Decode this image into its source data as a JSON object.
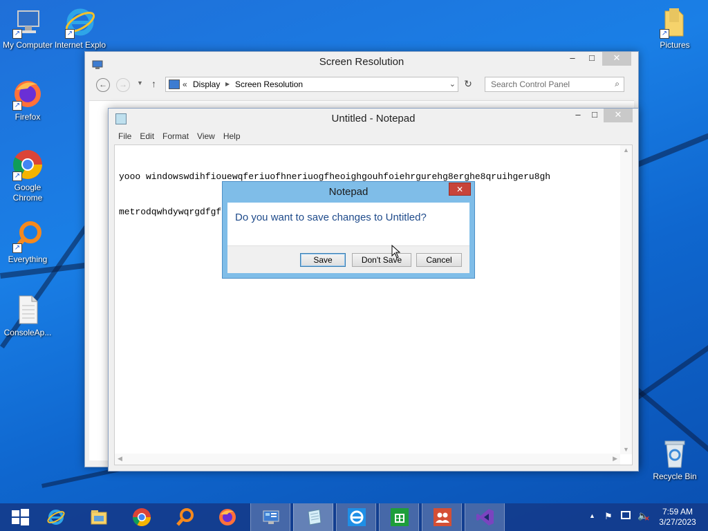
{
  "desktop": {
    "icons": [
      {
        "label": "My Computer",
        "icon": "computer-icon"
      },
      {
        "label": "Internet Explo",
        "icon": "internet-explorer-icon"
      },
      {
        "label": "Firefox",
        "icon": "firefox-icon"
      },
      {
        "label": "Google Chrome",
        "icon": "chrome-icon"
      },
      {
        "label": "Everything",
        "icon": "everything-search-icon"
      },
      {
        "label": "ConsoleAp...",
        "icon": "file-icon"
      },
      {
        "label": "Pictures",
        "icon": "folder-icon"
      },
      {
        "label": "Recycle Bin",
        "icon": "recycle-bin-icon"
      }
    ]
  },
  "control_panel": {
    "title": "Screen Resolution",
    "breadcrumb": {
      "root": "«",
      "parts": [
        "Display",
        "Screen Resolution"
      ]
    },
    "search_placeholder": "Search Control Panel",
    "controls": {
      "minimize": "–",
      "maximize": "□",
      "close": "✕"
    }
  },
  "notepad": {
    "title": "Untitled - Notepad",
    "menu": [
      "File",
      "Edit",
      "Format",
      "View",
      "Help"
    ],
    "content_line1": "yooo windowswdihfiouewqferiuofhneriuogfheoighgouhfoiehrgurehg8erghe8qruihgeru8gh",
    "content_line2": "metrodqwhdywqrgdfgfg"
  },
  "dialog": {
    "title": "Notepad",
    "message": "Do you want to save changes to Untitled?",
    "buttons": {
      "save": "Save",
      "dont_save": "Don't Save",
      "cancel": "Cancel"
    },
    "close": "✕"
  },
  "taskbar": {
    "time": "7:59 AM",
    "date": "3/27/2023",
    "pinned": [
      "start-icon",
      "internet-explorer-icon",
      "file-explorer-icon",
      "chrome-icon",
      "everything-search-icon",
      "firefox-icon",
      "control-panel-icon",
      "notepad-icon",
      "internet-explorer-icon",
      "store-icon",
      "people-icon",
      "visual-studio-icon"
    ]
  },
  "colors": {
    "accent": "#1a7fe6",
    "dialog_title": "#1e4a8a",
    "close_red": "#c7443a"
  }
}
